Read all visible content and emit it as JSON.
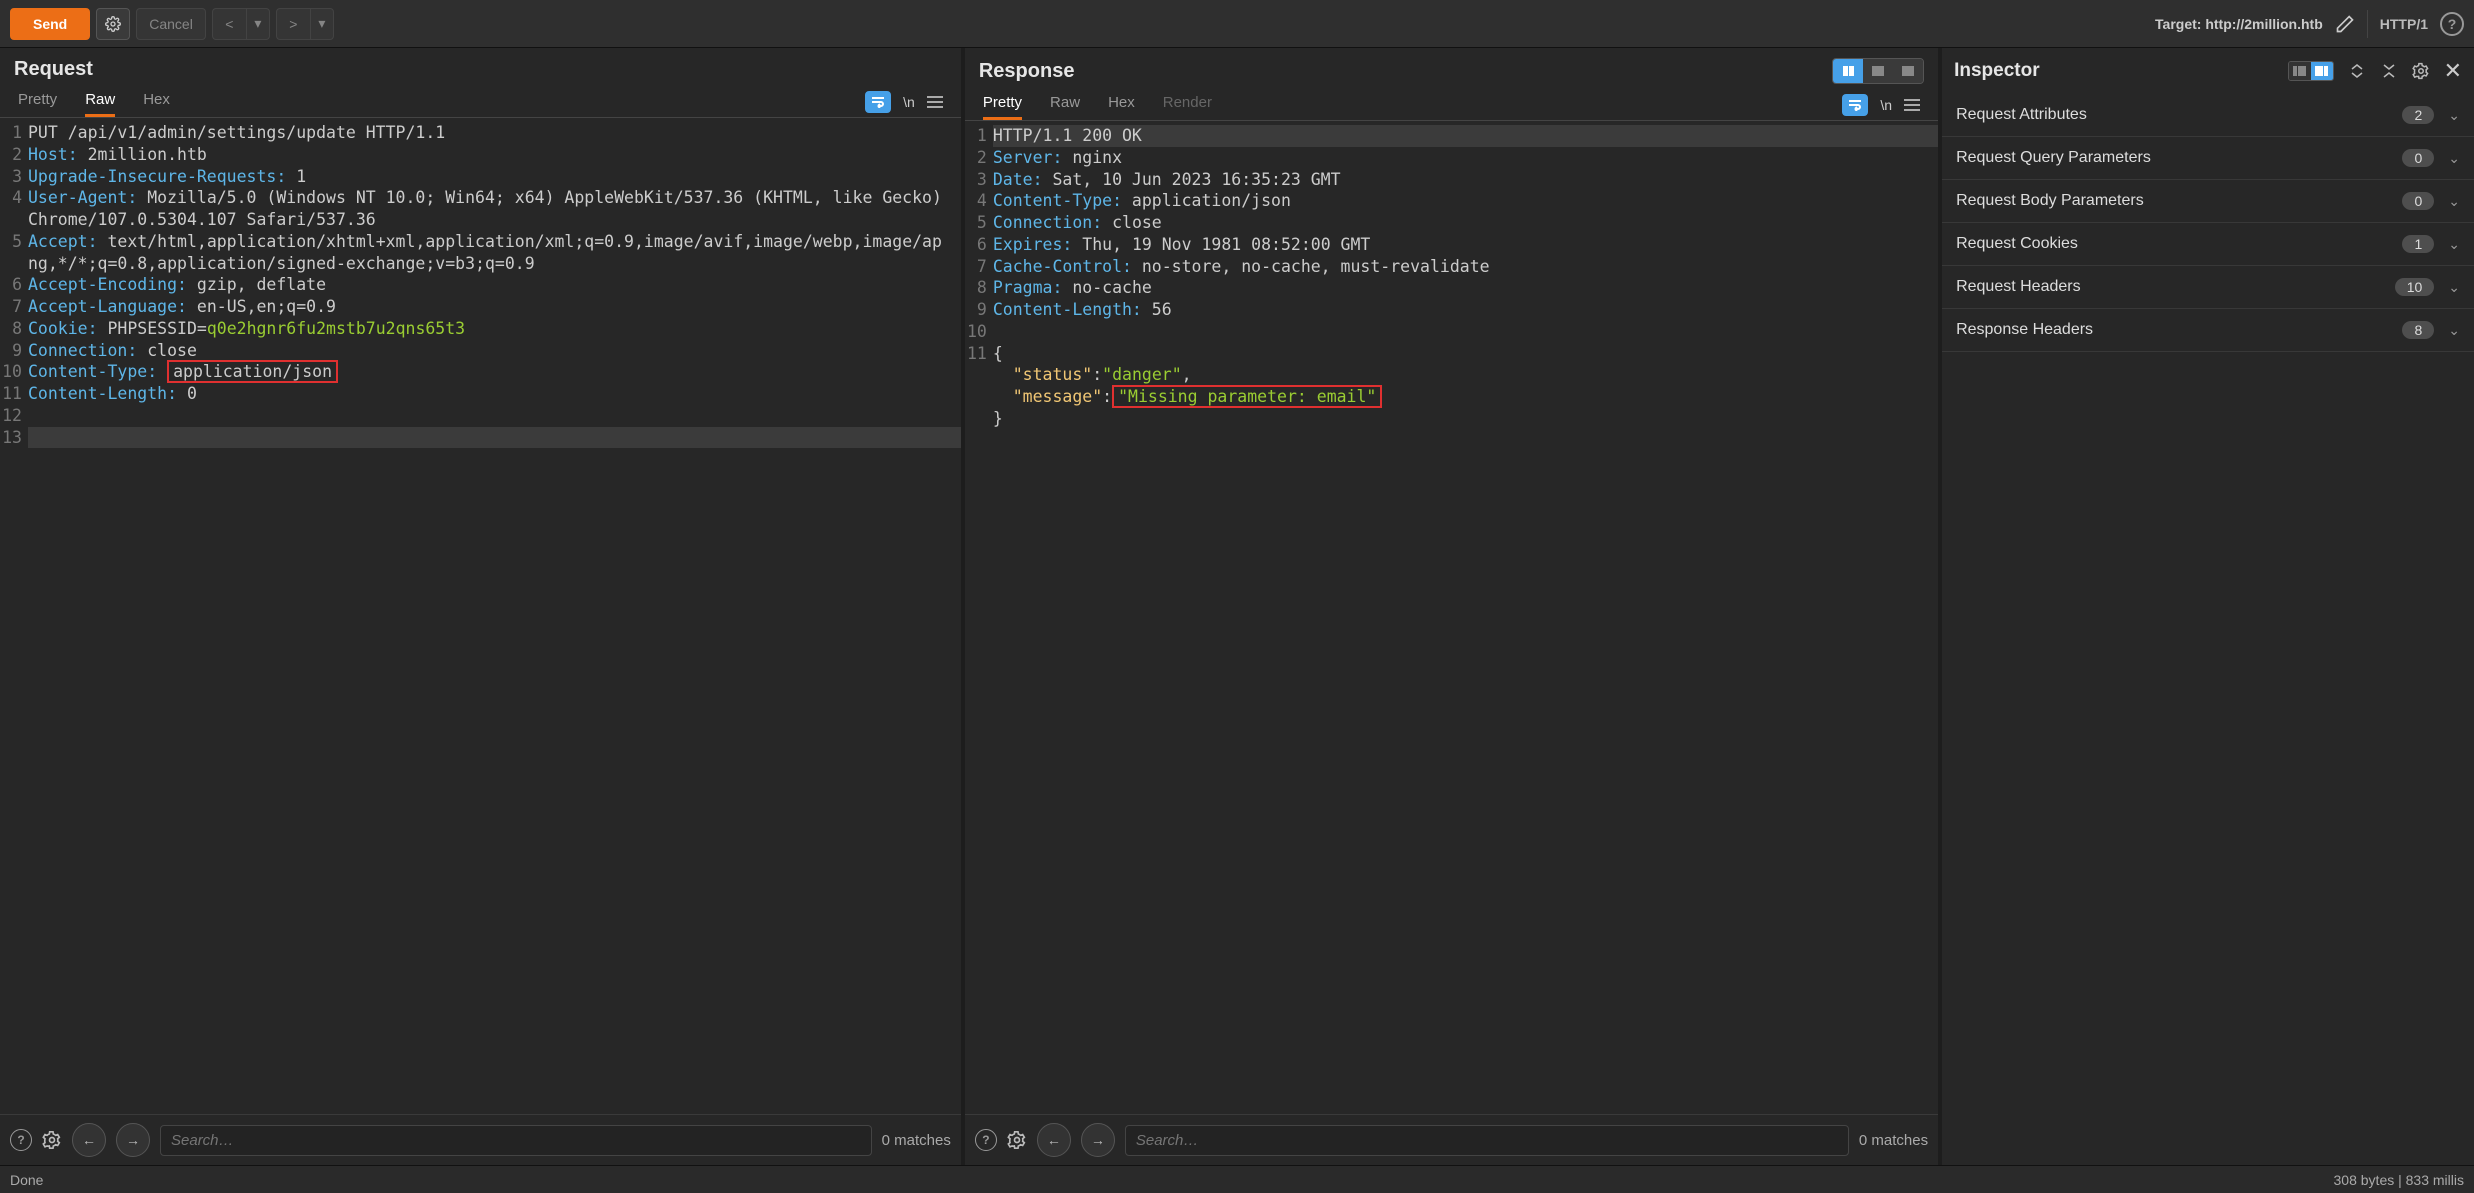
{
  "toolbar": {
    "send": "Send",
    "cancel": "Cancel",
    "target_prefix": "Target: ",
    "target": "http://2million.htb",
    "http_version": "HTTP/1"
  },
  "request": {
    "title": "Request",
    "tabs": {
      "pretty": "Pretty",
      "raw": "Raw",
      "hex": "Hex"
    },
    "newline_label": "\\n",
    "lines": [
      {
        "n": 1,
        "segs": [
          {
            "t": "PUT /api/v1/admin/settings/update HTTP/1.1",
            "c": "val"
          }
        ]
      },
      {
        "n": 2,
        "segs": [
          {
            "t": "Host:",
            "c": "hdr"
          },
          {
            "t": " 2million.htb",
            "c": "val"
          }
        ]
      },
      {
        "n": 3,
        "segs": [
          {
            "t": "Upgrade-Insecure-Requests:",
            "c": "hdr"
          },
          {
            "t": " 1",
            "c": "val"
          }
        ]
      },
      {
        "n": 4,
        "segs": [
          {
            "t": "User-Agent:",
            "c": "hdr"
          },
          {
            "t": " Mozilla/5.0 (Windows NT 10.0; Win64; x64) AppleWebKit/537.36 (KHTML, like Gecko) Chrome/107.0.5304.107 Safari/537.36",
            "c": "val"
          }
        ]
      },
      {
        "n": 5,
        "segs": [
          {
            "t": "Accept:",
            "c": "hdr"
          },
          {
            "t": " text/html,application/xhtml+xml,application/xml;q=0.9,image/avif,image/webp,image/apng,*/*;q=0.8,application/signed-exchange;v=b3;q=0.9",
            "c": "val"
          }
        ]
      },
      {
        "n": 6,
        "segs": [
          {
            "t": "Accept-Encoding:",
            "c": "hdr"
          },
          {
            "t": " gzip, deflate",
            "c": "val"
          }
        ]
      },
      {
        "n": 7,
        "segs": [
          {
            "t": "Accept-Language:",
            "c": "hdr"
          },
          {
            "t": " en-US,en;q=0.9",
            "c": "val"
          }
        ]
      },
      {
        "n": 8,
        "segs": [
          {
            "t": "Cookie:",
            "c": "hdr"
          },
          {
            "t": " PHPSESSID=",
            "c": "val"
          },
          {
            "t": "q0e2hgnr6fu2mstb7u2qns65t3",
            "c": "str"
          }
        ]
      },
      {
        "n": 9,
        "segs": [
          {
            "t": "Connection:",
            "c": "hdr"
          },
          {
            "t": " close",
            "c": "val"
          }
        ]
      },
      {
        "n": 10,
        "segs": [
          {
            "t": "Content-Type:",
            "c": "hdr"
          },
          {
            "t": " ",
            "c": "val"
          },
          {
            "t": "application/json",
            "c": "val",
            "box": true
          }
        ]
      },
      {
        "n": 11,
        "segs": [
          {
            "t": "Content-Length:",
            "c": "hdr"
          },
          {
            "t": " 0",
            "c": "val"
          }
        ]
      },
      {
        "n": 12,
        "segs": [
          {
            "t": "",
            "c": "val"
          }
        ]
      },
      {
        "n": 13,
        "hl": true,
        "segs": [
          {
            "t": " ",
            "c": "val"
          }
        ]
      }
    ],
    "search_placeholder": "Search…",
    "matches": "0 matches"
  },
  "response": {
    "title": "Response",
    "tabs": {
      "pretty": "Pretty",
      "raw": "Raw",
      "hex": "Hex",
      "render": "Render"
    },
    "newline_label": "\\n",
    "lines": [
      {
        "n": 1,
        "hl": true,
        "segs": [
          {
            "t": "HTTP/1.1 200 OK",
            "c": "val"
          }
        ]
      },
      {
        "n": 2,
        "segs": [
          {
            "t": "Server:",
            "c": "hdr"
          },
          {
            "t": " nginx",
            "c": "val"
          }
        ]
      },
      {
        "n": 3,
        "segs": [
          {
            "t": "Date:",
            "c": "hdr"
          },
          {
            "t": " Sat, 10 Jun 2023 16:35:23 GMT",
            "c": "val"
          }
        ]
      },
      {
        "n": 4,
        "segs": [
          {
            "t": "Content-Type:",
            "c": "hdr"
          },
          {
            "t": " application/json",
            "c": "val"
          }
        ]
      },
      {
        "n": 5,
        "segs": [
          {
            "t": "Connection:",
            "c": "hdr"
          },
          {
            "t": " close",
            "c": "val"
          }
        ]
      },
      {
        "n": 6,
        "segs": [
          {
            "t": "Expires:",
            "c": "hdr"
          },
          {
            "t": " Thu, 19 Nov 1981 08:52:00 GMT",
            "c": "val"
          }
        ]
      },
      {
        "n": 7,
        "segs": [
          {
            "t": "Cache-Control:",
            "c": "hdr"
          },
          {
            "t": " no-store, no-cache, must-revalidate",
            "c": "val"
          }
        ]
      },
      {
        "n": 8,
        "segs": [
          {
            "t": "Pragma:",
            "c": "hdr"
          },
          {
            "t": " no-cache",
            "c": "val"
          }
        ]
      },
      {
        "n": 9,
        "segs": [
          {
            "t": "Content-Length:",
            "c": "hdr"
          },
          {
            "t": " 56",
            "c": "val"
          }
        ]
      },
      {
        "n": 10,
        "segs": [
          {
            "t": "",
            "c": "val"
          }
        ]
      },
      {
        "n": 11,
        "segs": [
          {
            "t": "{",
            "c": "val"
          }
        ]
      },
      {
        "n": "",
        "segs": [
          {
            "t": "  \"status\"",
            "c": "strw"
          },
          {
            "t": ":",
            "c": "val"
          },
          {
            "t": "\"danger\"",
            "c": "str"
          },
          {
            "t": ",",
            "c": "val"
          }
        ]
      },
      {
        "n": "",
        "segs": [
          {
            "t": "  \"message\"",
            "c": "strw"
          },
          {
            "t": ":",
            "c": "val"
          },
          {
            "t": "\"Missing parameter: email\"",
            "c": "str",
            "box": true
          }
        ]
      },
      {
        "n": "",
        "segs": [
          {
            "t": "}",
            "c": "val"
          }
        ]
      }
    ],
    "search_placeholder": "Search…",
    "matches": "0 matches"
  },
  "inspector": {
    "title": "Inspector",
    "rows": [
      {
        "label": "Request Attributes",
        "count": "2"
      },
      {
        "label": "Request Query Parameters",
        "count": "0"
      },
      {
        "label": "Request Body Parameters",
        "count": "0"
      },
      {
        "label": "Request Cookies",
        "count": "1"
      },
      {
        "label": "Request Headers",
        "count": "10"
      },
      {
        "label": "Response Headers",
        "count": "8"
      }
    ]
  },
  "statusbar": {
    "left": "Done",
    "right": "308 bytes | 833 millis"
  }
}
